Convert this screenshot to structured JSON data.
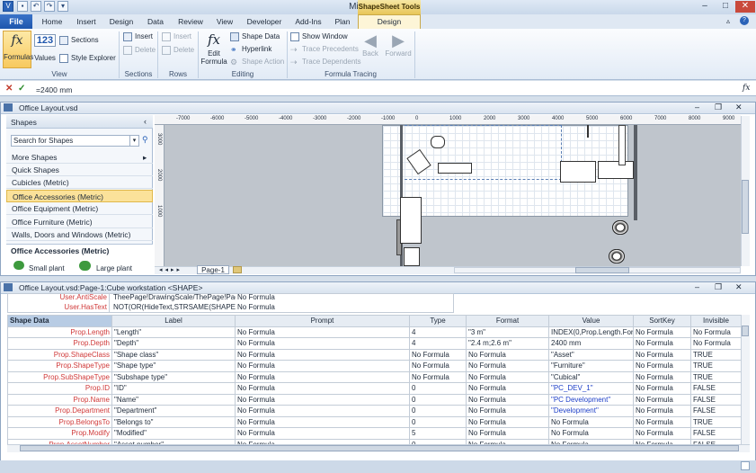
{
  "app": {
    "title": "Microsoft Visio",
    "context_tab": "ShapeSheet Tools"
  },
  "tabs": [
    "File",
    "Home",
    "Insert",
    "Design",
    "Data",
    "Review",
    "View",
    "Developer",
    "Add-Ins",
    "Plan",
    "Design"
  ],
  "ribbon": {
    "view": {
      "formulas": "Formulas",
      "values": "Values",
      "sections": "Sections",
      "style_explorer": "Style Explorer",
      "label": "View"
    },
    "sections": {
      "insert": "Insert",
      "delete": "Delete",
      "label": "Sections"
    },
    "rows": {
      "insert": "Insert",
      "delete": "Delete",
      "label": "Rows"
    },
    "editing": {
      "edit_formula_1": "Edit",
      "edit_formula_2": "Formula",
      "shape_data": "Shape Data",
      "hyperlink": "Hyperlink",
      "shape_action": "Shape Action",
      "label": "Editing"
    },
    "tracing": {
      "show_window": "Show Window",
      "trace_precedents": "Trace Precedents",
      "trace_dependents": "Trace Dependents",
      "back": "Back",
      "forward": "Forward",
      "label": "Formula Tracing"
    }
  },
  "formula_bar": {
    "value": "=2400 mm"
  },
  "doc_window": {
    "title": "Office Layout.vsd",
    "page_tab": "Page-1"
  },
  "shapes_panel": {
    "title": "Shapes",
    "search_placeholder": "Search for Shapes",
    "items": [
      "More Shapes",
      "Quick Shapes",
      "Cubicles (Metric)",
      "Office Accessories (Metric)",
      "Office Equipment (Metric)",
      "Office Furniture (Metric)",
      "Walls, Doors and Windows (Metric)"
    ],
    "stencil_title": "Office Accessories (Metric)",
    "stencil_items": [
      "Small plant",
      "Large plant"
    ]
  },
  "ruler": {
    "labels": [
      "-7000",
      "-6000",
      "-5000",
      "-4000",
      "-3000",
      "-2000",
      "-1000",
      "0",
      "1000",
      "2000",
      "3000",
      "4000",
      "5000",
      "6000",
      "7000",
      "8000",
      "9000"
    ],
    "vlabels": [
      "3000",
      "2000",
      "1000"
    ]
  },
  "shapesheet": {
    "title": "Office Layout.vsd:Page-1:Cube workstation <SHAPE>",
    "top_rows": [
      [
        "User.AntiScale",
        "TheePage!DrawingScale/ThePage!PageS",
        "No Formula"
      ],
      [
        "User.HasText",
        "NOT(OR(HideText,STRSAME(SHAPETE)",
        "No Formula"
      ]
    ],
    "headers": [
      "Shape Data",
      "Label",
      "Prompt",
      "Type",
      "Format",
      "Value",
      "SortKey",
      "Invisible"
    ],
    "rows": [
      [
        "Prop.Length",
        "\"Length\"",
        "No Formula",
        "4",
        "\"3 m\"",
        "INDEX(0,Prop.Length.Forr",
        "No Formula",
        "No Formula"
      ],
      [
        "Prop.Depth",
        "\"Depth\"",
        "No Formula",
        "4",
        "\"2.4 m;2.6 m\"",
        "2400 mm",
        "No Formula",
        "No Formula"
      ],
      [
        "Prop.ShapeClass",
        "\"Shape class\"",
        "No Formula",
        "No Formula",
        "No Formula",
        "\"Asset\"",
        "No Formula",
        "TRUE"
      ],
      [
        "Prop.ShapeType",
        "\"Shape type\"",
        "No Formula",
        "No Formula",
        "No Formula",
        "\"Furniture\"",
        "No Formula",
        "TRUE"
      ],
      [
        "Prop.SubShapeType",
        "\"Subshape type\"",
        "No Formula",
        "No Formula",
        "No Formula",
        "\"Cubical\"",
        "No Formula",
        "TRUE"
      ],
      [
        "Prop.ID",
        "\"ID\"",
        "No Formula",
        "0",
        "No Formula",
        "\"PC_DEV_1\"",
        "No Formula",
        "FALSE"
      ],
      [
        "Prop.Name",
        "\"Name\"",
        "No Formula",
        "0",
        "No Formula",
        "\"PC Development\"",
        "No Formula",
        "FALSE"
      ],
      [
        "Prop.Department",
        "\"Department\"",
        "No Formula",
        "0",
        "No Formula",
        "\"Development\"",
        "No Formula",
        "FALSE"
      ],
      [
        "Prop.BelongsTo",
        "\"Belongs to\"",
        "No Formula",
        "0",
        "No Formula",
        "No Formula",
        "No Formula",
        "TRUE"
      ],
      [
        "Prop.Modify",
        "\"Modified\"",
        "No Formula",
        "5",
        "No Formula",
        "No Formula",
        "No Formula",
        "FALSE"
      ],
      [
        "Prop.AssetNumber",
        "\"Asset number\"",
        "No Formula",
        "0",
        "No Formula",
        "No Formula",
        "No Formula",
        "FALSE"
      ]
    ],
    "blue_values": [
      5,
      6,
      7
    ]
  },
  "colors": {
    "accent": "#1e56ad",
    "context": "#e8c659",
    "selected": "#fbe29a",
    "rowname": "#d03a3a"
  }
}
